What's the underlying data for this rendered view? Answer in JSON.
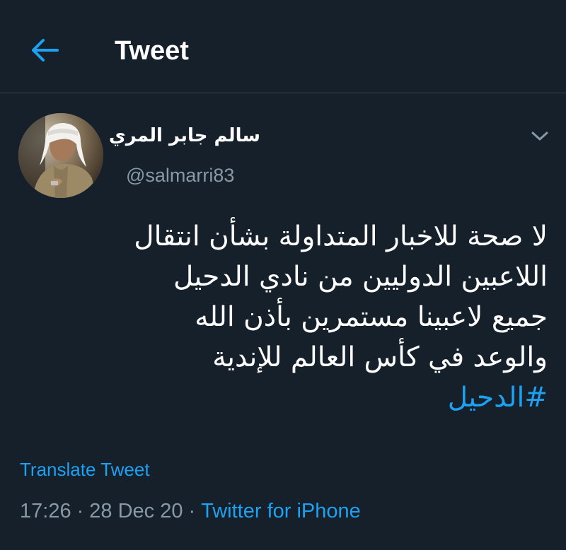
{
  "header": {
    "back_icon": "arrow-left-icon",
    "title": "Tweet"
  },
  "author": {
    "name": "سالم جابر المري",
    "handle": "@salmarri83",
    "avatar_icon": "user-avatar-photo"
  },
  "more_icon": "chevron-down-icon",
  "tweet": {
    "lines": [
      "لا صحة للاخبار المتداولة بشأن انتقال",
      "اللاعبين الدوليين من نادي الدحيل",
      "جميع لاعبينا مستمرين بأذن الله",
      "والوعد في كأس العالم للإندية"
    ],
    "hashtag": "#الدحيل"
  },
  "translate_label": "Translate Tweet",
  "meta": {
    "time": "17:26",
    "separator": "·",
    "date": "28 Dec 20",
    "source": "Twitter for iPhone"
  },
  "colors": {
    "background": "#15202b",
    "accent": "#1da1f2",
    "secondary_text": "#8899a6",
    "divider": "#38444d"
  }
}
